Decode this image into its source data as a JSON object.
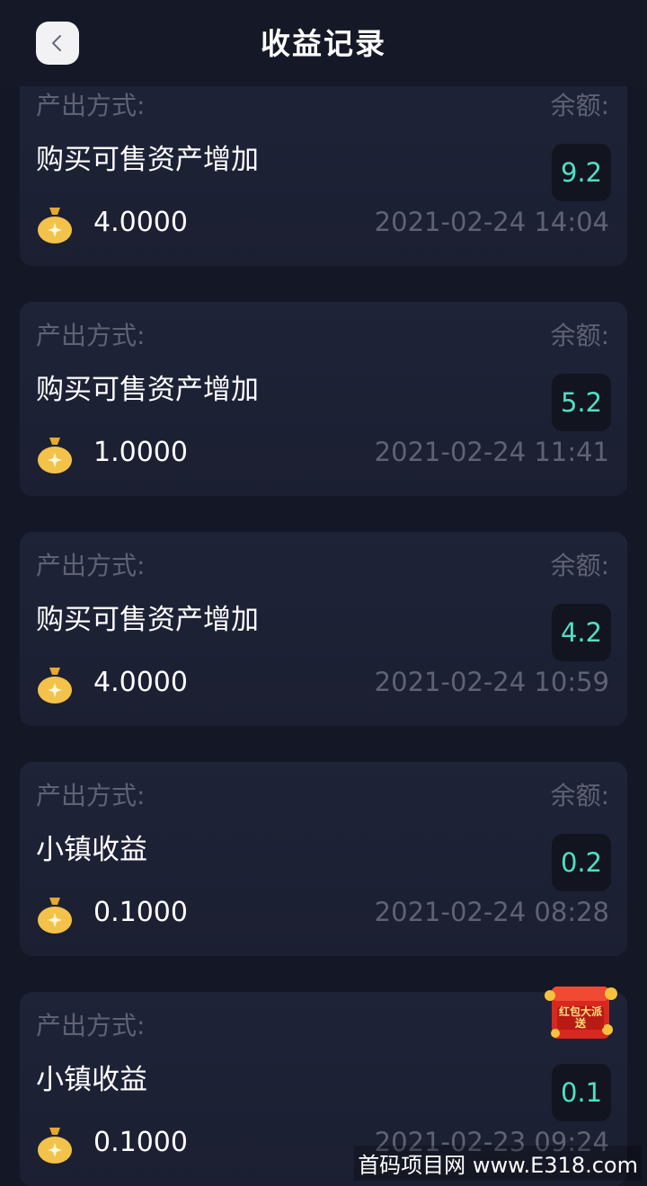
{
  "header": {
    "title": "收益记录",
    "back_icon": "chevron-left-icon"
  },
  "labels": {
    "method_label": "产出方式:",
    "balance_label": "余额:"
  },
  "records": [
    {
      "method": "购买可售资产增加",
      "balance": "9.2",
      "amount": "4.0000",
      "time": "2021-02-24 14:04"
    },
    {
      "method": "购买可售资产增加",
      "balance": "5.2",
      "amount": "1.0000",
      "time": "2021-02-24 11:41"
    },
    {
      "method": "购买可售资产增加",
      "balance": "4.2",
      "amount": "4.0000",
      "time": "2021-02-24 10:59"
    },
    {
      "method": "小镇收益",
      "balance": "0.2",
      "amount": "0.1000",
      "time": "2021-02-24 08:28"
    },
    {
      "method": "小镇收益",
      "balance": "0.1",
      "amount": "0.1000",
      "time": "2021-02-23 09:24"
    }
  ],
  "promo": {
    "text": "红包大派送",
    "icon": "red-packet-icon"
  },
  "watermark": "首码项目网 www.E318.com",
  "colors": {
    "background": "#131726",
    "card": "#1f2338",
    "balance_text": "#4fe0c4",
    "muted_text": "#5f6273",
    "coin": "#f3c24a"
  }
}
